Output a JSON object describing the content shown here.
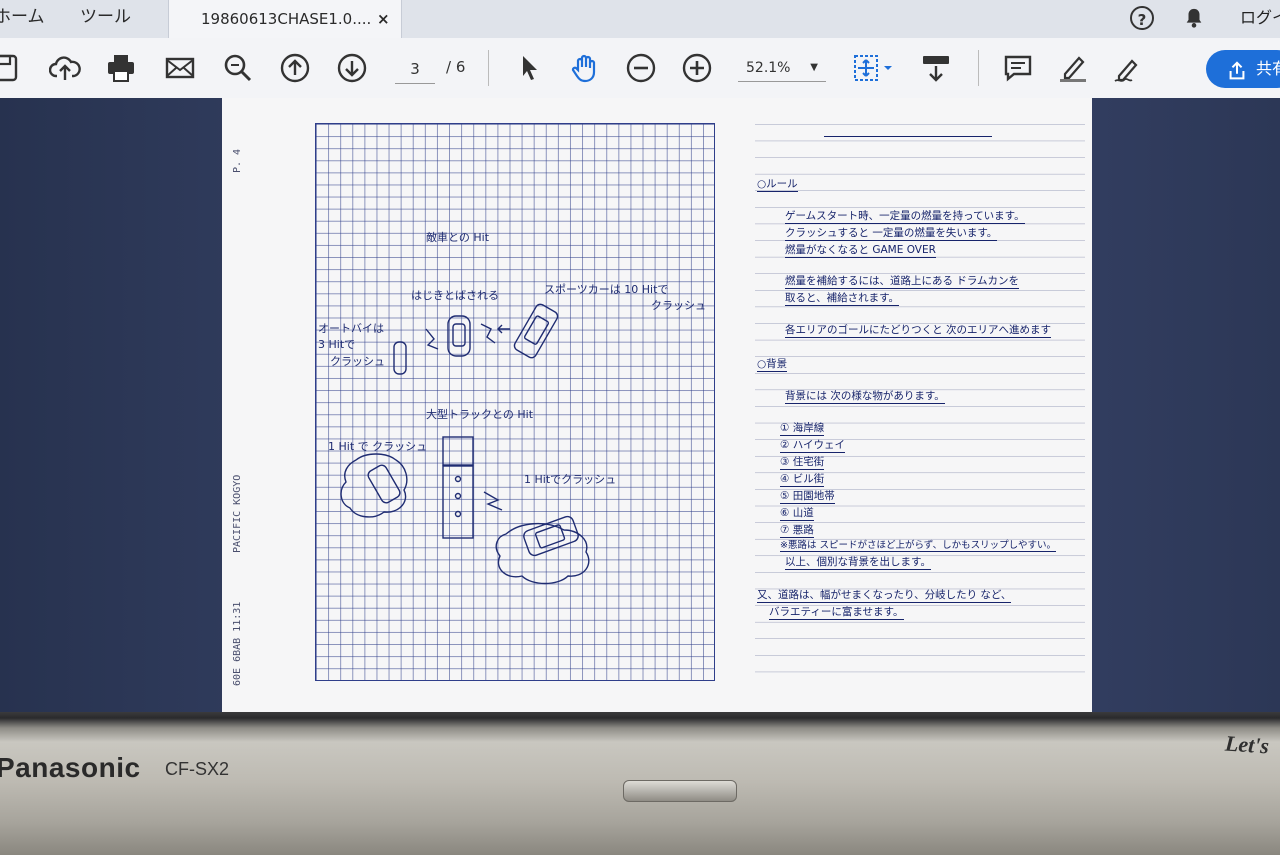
{
  "tabs": {
    "home": "ホーム",
    "tools": "ツール",
    "document": "19860613CHASE1.0....",
    "close": "×"
  },
  "header": {
    "help": "?",
    "login": "ログイン"
  },
  "toolbar": {
    "page_current": "3",
    "page_total": "/ 6",
    "zoom": "52.1%",
    "share": "共有"
  },
  "document": {
    "grid_page": {
      "page_label": "P. 4",
      "pacific_label": "PACIFIC KOGYO",
      "date_label": "60E 6BAB 11:31",
      "annotations": [
        "敵車との Hit",
        "はじきとばされる",
        "スポーツカーは 10 Hitで",
        "クラッシュ",
        "オートバイは",
        "3 Hitで",
        "クラッシュ",
        "大型トラックとの Hit",
        "1 Hit で クラッシュ",
        "1 Hitでクラッシュ"
      ]
    },
    "notes": [
      "○ルール",
      "ゲームスタート時、一定量の燃量を持っています。",
      "クラッシュすると 一定量の燃量を失います。",
      "燃量がなくなると GAME OVER",
      "燃量を補給するには、道路上にある ドラムカンを",
      "取ると、補給されます。",
      "各エリアのゴールにたどりつくと 次のエリアへ進めます",
      "○背景",
      "背景には 次の様な物があります。",
      "① 海岸線",
      "② ハイウェイ",
      "③ 住宅街",
      "④ ビル街",
      "⑤ 田園地帯",
      "⑥ 山道",
      "⑦ 悪路",
      "※悪路は スピードがさほど上がらず、しかもスリップしやすい。",
      "以上、個別な背景を出します。",
      "又、道路は、幅がせまくなったり、分岐したり など、",
      "バラエティーに富ませます。"
    ]
  },
  "bezel": {
    "brand": "Panasonic",
    "model": "CF-SX2",
    "logo": "Let's"
  },
  "colors": {
    "accent": "#1e6fd9",
    "ink": "#1f2c72",
    "toolbar": "#f3f4f7"
  }
}
